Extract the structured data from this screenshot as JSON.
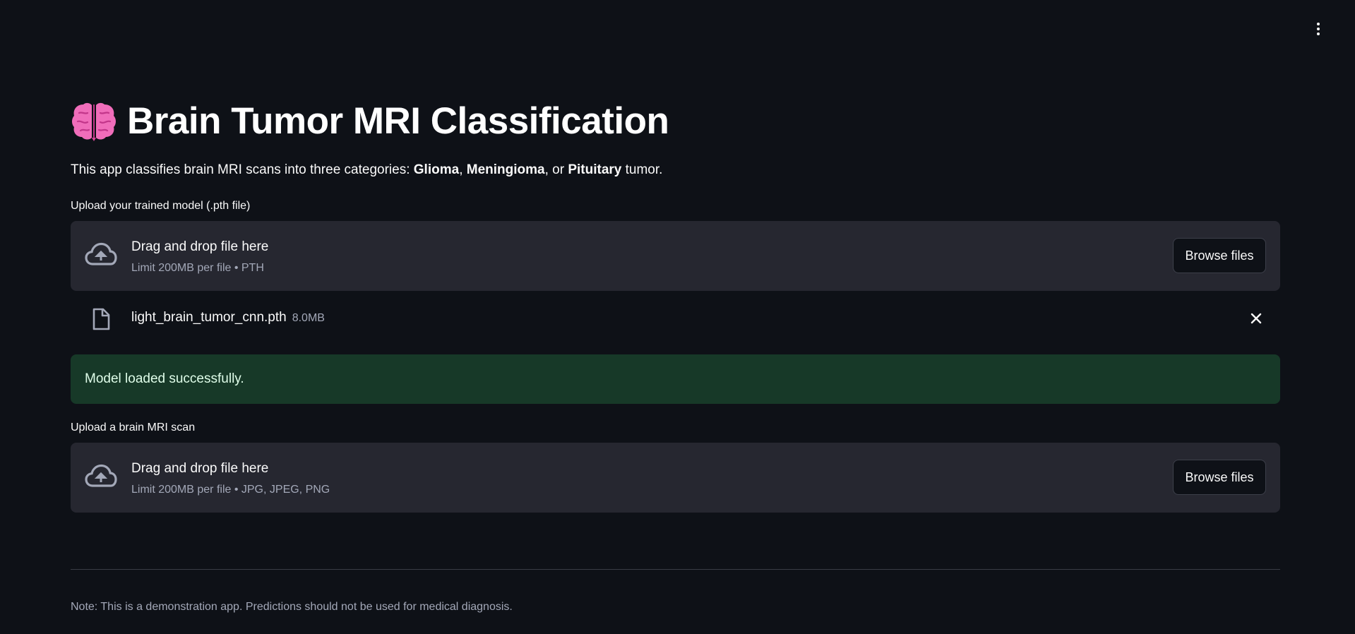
{
  "header": {
    "menu_icon": "more-vertical-icon"
  },
  "title": {
    "icon": "brain-icon",
    "text": "Brain Tumor MRI Classification"
  },
  "intro": {
    "prefix": "This app classifies brain MRI scans into three categories: ",
    "cat1": "Glioma",
    "sep1": ", ",
    "cat2": "Meningioma",
    "sep2": ", or ",
    "cat3": "Pituitary",
    "suffix": " tumor."
  },
  "model_upload": {
    "label": "Upload your trained model (.pth file)",
    "drop_title": "Drag and drop file here",
    "drop_sub": "Limit 200MB per file • PTH",
    "browse_label": "Browse files",
    "uploaded_file": {
      "name": "light_brain_tumor_cnn.pth",
      "size": "8.0MB"
    }
  },
  "status": {
    "text": "Model loaded successfully.",
    "color": "#173928"
  },
  "scan_upload": {
    "label": "Upload a brain MRI scan",
    "drop_title": "Drag and drop file here",
    "drop_sub": "Limit 200MB per file • JPG, JPEG, PNG",
    "browse_label": "Browse files"
  },
  "footer": {
    "note": "Note: This is a demonstration app. Predictions should not be used for medical diagnosis."
  },
  "colors": {
    "background": "#0e1117",
    "panel": "#262730",
    "success_bg": "#173928",
    "brain": "#f06dba"
  }
}
